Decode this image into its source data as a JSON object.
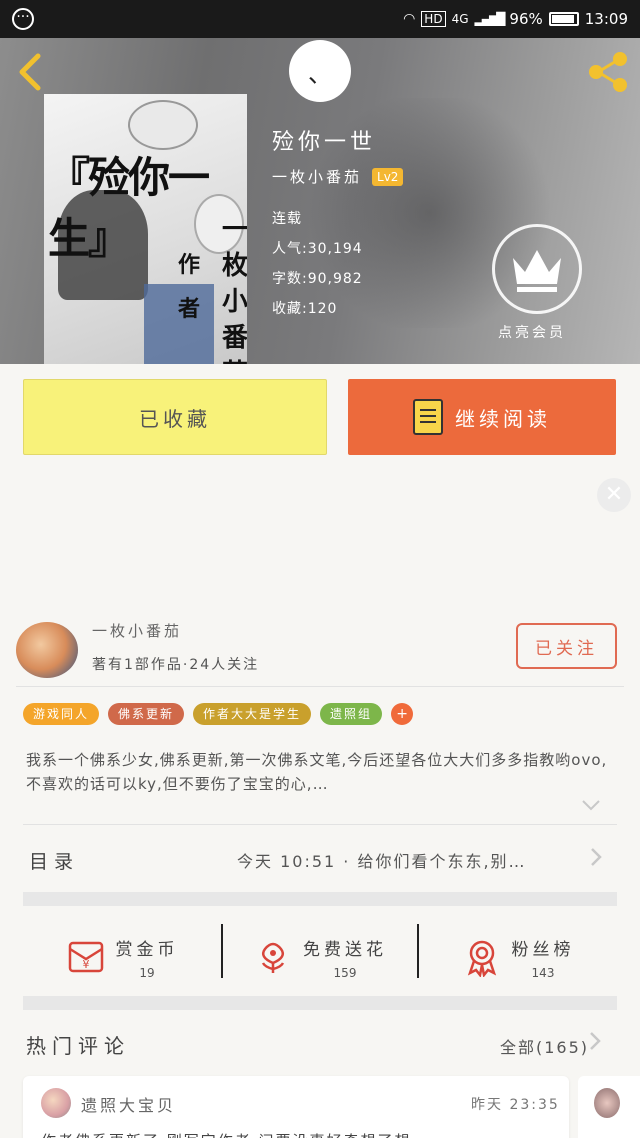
{
  "status_bar": {
    "network": "4G",
    "battery": "96%",
    "time": "13:09"
  },
  "header": {
    "center_avatar_glyph": "、",
    "cover": {
      "title": "『殓你一生』",
      "author_vertical": "一枚小番茄",
      "by_vertical": "作者"
    },
    "book_title": "殓你一世",
    "author_name": "一枚小番茄",
    "author_level": "Lv2",
    "status": "连载",
    "popularity": "人气:30,194",
    "word_count": "字数:90,982",
    "favorites": "收藏:120",
    "vip_label": "点亮会员"
  },
  "actions": {
    "collected_label": "已收藏",
    "continue_label": "继续阅读"
  },
  "author": {
    "name": "一枚小番茄",
    "stats": "著有1部作品·24人关注",
    "follow_label": "已关注"
  },
  "tags": [
    {
      "label": "游戏同人",
      "color": "#f4a52a"
    },
    {
      "label": "佛系更新",
      "color": "#d0694a"
    },
    {
      "label": "作者大大是学生",
      "color": "#c9a02c"
    },
    {
      "label": "遗照组",
      "color": "#7db64a"
    }
  ],
  "tag_add": "+",
  "description": "我系一个佛系少女,佛系更新,第一次佛系文笔,今后还望各位大大们多多指教哟ovo,不喜欢的话可以ky,但不要伤了宝宝的心,…",
  "toc": {
    "label": "目录",
    "latest": "今天 10:51 · 给你们看个东东,别…"
  },
  "stats": [
    {
      "label": "赏金币",
      "value": "19",
      "icon": "red-envelope-icon"
    },
    {
      "label": "免费送花",
      "value": "159",
      "icon": "flower-icon"
    },
    {
      "label": "粉丝榜",
      "value": "143",
      "icon": "medal-icon"
    }
  ],
  "comments": {
    "title": "热门评论",
    "all_label": "全部(165)",
    "first": {
      "user": "遗照大宝贝",
      "time": "昨天 23:35",
      "text": "作者佛系更新了,刚写完作者,问要没事好奇想了想..."
    }
  },
  "colors": {
    "accent_orange": "#ec6a3c",
    "collected_yellow": "#f8f27a",
    "follow_red": "#e06a52",
    "back_yellow": "#f2c12e"
  }
}
